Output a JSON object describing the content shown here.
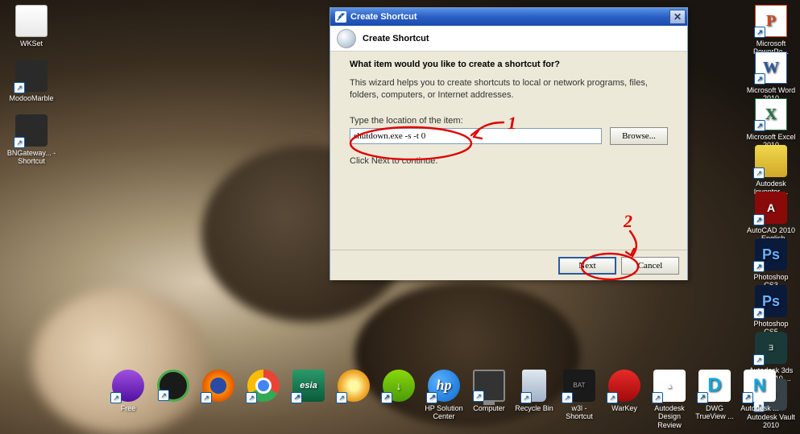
{
  "dialog": {
    "title": "Create Shortcut",
    "header": "Create Shortcut",
    "question": "What item would you like to create a shortcut for?",
    "description": "This wizard helps you to create shortcuts to local or network programs, files, folders, computers, or Internet addresses.",
    "field_label": "Type the location of the item:",
    "field_value": "shutdown.exe -s -t 0",
    "browse_label": "Browse...",
    "continue_text": "Click Next to continue.",
    "next_label": "Next",
    "cancel_label": "Cancel",
    "close_symbol": "✕"
  },
  "annotations": {
    "mark1": "1",
    "mark2": "2"
  },
  "desktop_left": [
    {
      "name": "wkset",
      "label": "WKSet",
      "style": "ig-doc"
    },
    {
      "name": "modoomarble",
      "label": "ModooMarble",
      "style": "ig-char"
    },
    {
      "name": "bngateway",
      "label": "BNGateway... - Shortcut",
      "style": "ig-char"
    }
  ],
  "desktop_right": [
    {
      "name": "powerpoint",
      "label": "Microsoft PowerPo...",
      "style": "ig-ppt",
      "glyph": "P"
    },
    {
      "name": "word",
      "label": "Microsoft Word 2010",
      "style": "ig-word",
      "glyph": "W"
    },
    {
      "name": "excel",
      "label": "Microsoft Excel 2010",
      "style": "ig-excel",
      "glyph": "X"
    },
    {
      "name": "inventor",
      "label": "Autodesk Inventor ...",
      "style": "ig-yellow",
      "glyph": ""
    },
    {
      "name": "autocad",
      "label": "AutoCAD 2010 - English",
      "style": "ig-acad",
      "glyph": "A"
    },
    {
      "name": "pscs3",
      "label": "Photoshop CS3",
      "style": "ig-ps",
      "glyph": "Ps"
    },
    {
      "name": "pscs5",
      "label": "Photoshop CS5",
      "style": "ig-ps",
      "glyph": "Ps"
    },
    {
      "name": "3dsmax",
      "label": "Autodesk 3ds Max 2010 ...",
      "style": "ig-max",
      "glyph": "Ǝ"
    },
    {
      "name": "vault",
      "label": "Autodesk Vault 2010",
      "style": "ig-vault",
      "glyph": "⌀"
    }
  ],
  "bottom_icons": [
    {
      "name": "free",
      "label": "Free",
      "style": "ig-purple"
    },
    {
      "name": "webcam",
      "label": "",
      "style": "ig-cam"
    },
    {
      "name": "firefox",
      "label": "",
      "style": "ig-firefox"
    },
    {
      "name": "chrome",
      "label": "",
      "style": "ig-chrome"
    },
    {
      "name": "esia",
      "label": "",
      "style": "ig-esia",
      "glyph": "esia"
    },
    {
      "name": "sun",
      "label": "",
      "style": "ig-sun"
    },
    {
      "name": "lime",
      "label": "",
      "style": "ig-lime",
      "glyph": "↓"
    },
    {
      "name": "hp",
      "label": "HP Solution Center",
      "style": "ig-hp",
      "glyph": "hp"
    },
    {
      "name": "computer",
      "label": "Computer",
      "style": "ig-monitor"
    },
    {
      "name": "recycle",
      "label": "Recycle Bin",
      "style": "ig-bin"
    },
    {
      "name": "w3l",
      "label": "w3l - Shortcut",
      "style": "ig-bat",
      "glyph": "BAT"
    },
    {
      "name": "warkey",
      "label": "WarKey",
      "style": "ig-red"
    },
    {
      "name": "adr",
      "label": "Autodesk Design Review",
      "style": "ig-adr",
      "glyph": "▲"
    },
    {
      "name": "dwg",
      "label": "DWG TrueView ...",
      "style": "ig-dwg",
      "glyph": "D"
    },
    {
      "name": "navisworks",
      "label": "Autodesk ...",
      "style": "ig-nav",
      "glyph": "N"
    }
  ]
}
